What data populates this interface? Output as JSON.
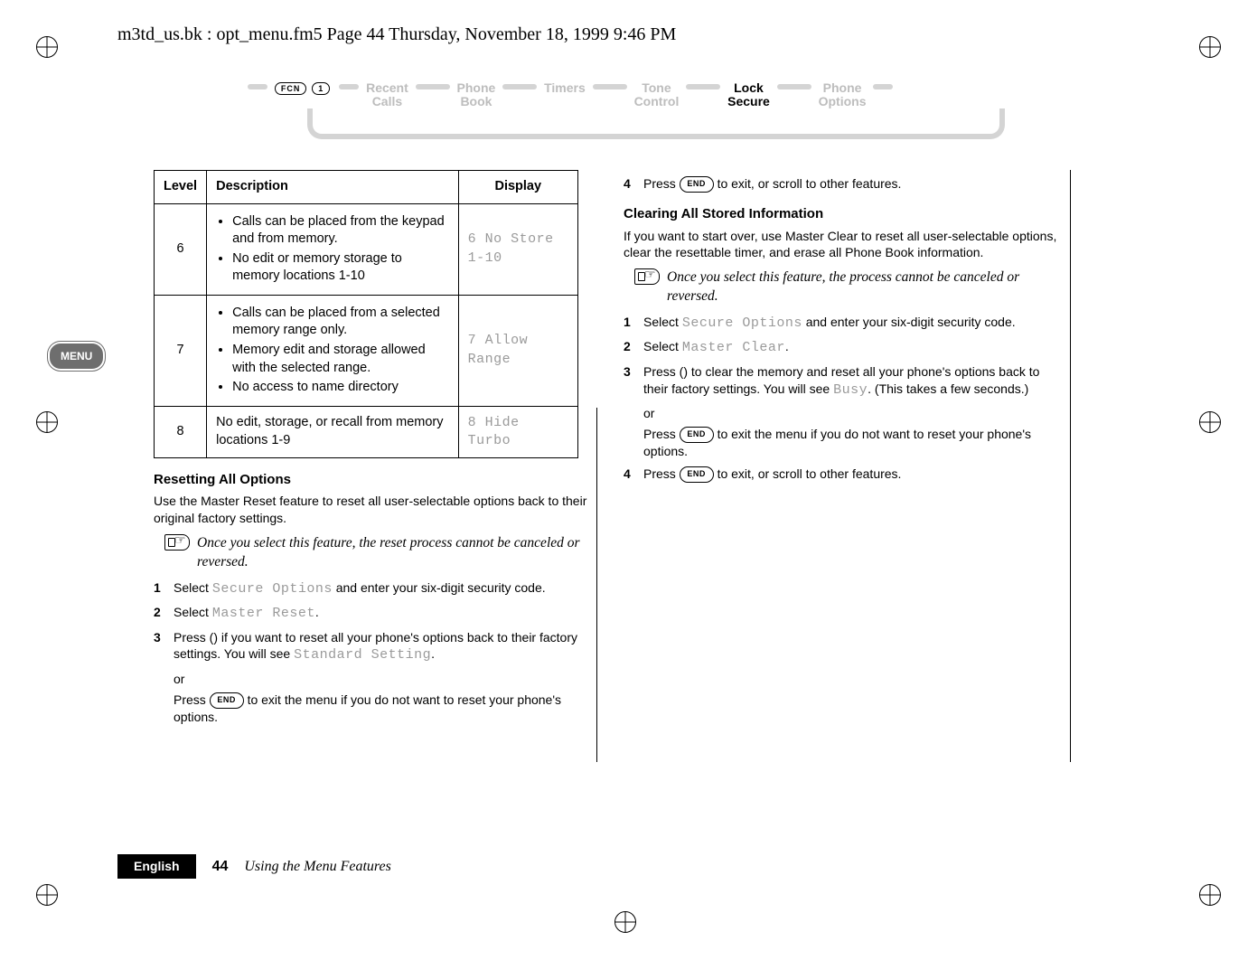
{
  "header": "m3td_us.bk : opt_menu.fm5  Page 44  Thursday, November 18, 1999  9:46 PM",
  "nav": {
    "fcn": "FCN",
    "one": "1",
    "items": [
      {
        "line1": "Recent",
        "line2": "Calls",
        "active": false
      },
      {
        "line1": "Phone",
        "line2": "Book",
        "active": false
      },
      {
        "line1": "Timers",
        "line2": "",
        "active": false
      },
      {
        "line1": "Tone",
        "line2": "Control",
        "active": false
      },
      {
        "line1": "Lock",
        "line2": "Secure",
        "active": true
      },
      {
        "line1": "Phone",
        "line2": "Options",
        "active": false
      }
    ]
  },
  "table": {
    "headers": {
      "level": "Level",
      "description": "Description",
      "display": "Display"
    },
    "rows": [
      {
        "level": "6",
        "bullets": [
          "Calls can be placed from the keypad and from memory.",
          "No edit or memory storage to memory locations 1-10"
        ],
        "display": "6 No Store\n1-10"
      },
      {
        "level": "7",
        "bullets": [
          "Calls can be placed from a selected memory range only.",
          "Memory edit and storage allowed with the selected range.",
          "No access to name directory"
        ],
        "display": "7 Allow Range"
      },
      {
        "level": "8",
        "plain": "No edit, storage, or recall from memory locations 1-9",
        "display": "8 Hide Turbo"
      }
    ]
  },
  "left": {
    "h1": "Resetting All Options",
    "intro": "Use the Master Reset feature to reset all user-selectable options back to their original factory settings.",
    "note": "Once you select this feature, the reset process cannot be canceled or reversed.",
    "steps": {
      "s1a": "Select ",
      "s1code": "Secure Options",
      "s1b": " and enter your six-digit security code.",
      "s2a": "Select ",
      "s2code": "Master Reset",
      "s2b": ".",
      "s3a": "Press () if you want to reset all your phone's options back to their factory settings. You will see ",
      "s3code": "Standard Setting",
      "s3b": ".",
      "or": "or",
      "s3alt_a": "Press ",
      "s3alt_key": "END",
      "s3alt_b": " to exit the menu if you do not want to reset your phone's options."
    }
  },
  "right": {
    "top_step4_a": "Press ",
    "top_step4_key": "END",
    "top_step4_b": " to exit, or scroll to other features.",
    "h1": "Clearing All Stored Information",
    "intro": "If you want to start over, use Master Clear to reset all user-selectable options, clear the resettable timer, and erase all Phone Book information.",
    "note": "Once you select this feature, the process cannot be canceled or reversed.",
    "steps": {
      "s1a": "Select ",
      "s1code": "Secure Options",
      "s1b": " and enter your six-digit security code.",
      "s2a": "Select ",
      "s2code": "Master Clear",
      "s2b": ".",
      "s3a": "Press () to clear the memory and reset all your phone's options back to their factory settings. You will see ",
      "s3code": "Busy",
      "s3b": ". (This takes a few seconds.)",
      "or": "or",
      "s3alt_a": "Press ",
      "s3alt_key": "END",
      "s3alt_b": " to exit the menu if you do not want to reset your phone's options.",
      "s4a": "Press ",
      "s4key": "END",
      "s4b": " to exit, or scroll to other features."
    }
  },
  "menu_tab": "MENU",
  "footer": {
    "language": "English",
    "page": "44",
    "chapter": "Using the Menu Features"
  }
}
